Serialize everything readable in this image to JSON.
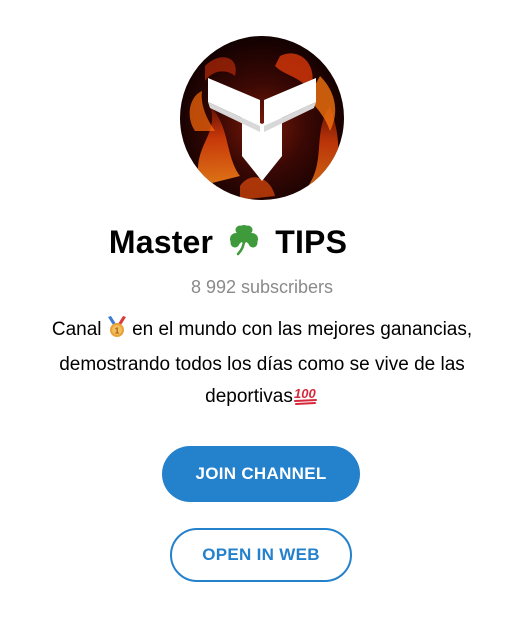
{
  "channel": {
    "title_part1": "Master",
    "title_part2": "TIPS",
    "title_emoji_icon": "shamrock-icon",
    "subscribers": "8 992 subscribers",
    "description": {
      "line1_a": "Canal",
      "line1_emoji_icon": "medal-icon",
      "line1_b": "en el mundo con las mejores ganancias,",
      "line2": "demostrando todos los días como se vive de las",
      "line3": "deportivas",
      "line3_emoji_icon": "hundred-points-icon"
    }
  },
  "buttons": {
    "join_label": "JOIN CHANNEL",
    "web_label": "OPEN IN WEB"
  },
  "colors": {
    "accent": "#2481cc",
    "subtitle": "#8a8a8a",
    "text": "#000000",
    "background": "#ffffff"
  }
}
